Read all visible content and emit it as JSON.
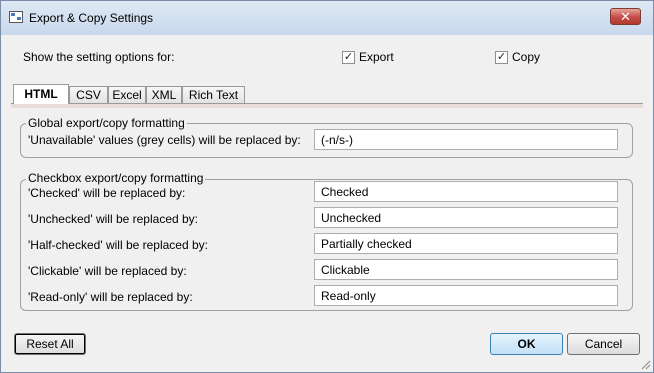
{
  "window": {
    "title": "Export & Copy Settings",
    "close_label": "✕"
  },
  "show_options": {
    "label": "Show the setting options for:",
    "export": {
      "label": "Export",
      "checked": true
    },
    "copy": {
      "label": "Copy",
      "checked": true
    }
  },
  "tabs": [
    {
      "label": "HTML",
      "active": true
    },
    {
      "label": "CSV",
      "active": false
    },
    {
      "label": "Excel",
      "active": false
    },
    {
      "label": "XML",
      "active": false
    },
    {
      "label": "Rich Text",
      "active": false
    }
  ],
  "global_group": {
    "title": "Global export/copy formatting",
    "unavailable_label": "'Unavailable' values (grey cells) will be replaced by:",
    "unavailable_value": "(-n/s-)"
  },
  "checkbox_group": {
    "title": "Checkbox export/copy formatting",
    "rows": [
      {
        "label": "'Checked' will be replaced by:",
        "value": "Checked"
      },
      {
        "label": "'Unchecked' will be replaced by:",
        "value": "Unchecked"
      },
      {
        "label": "'Half-checked' will be replaced by:",
        "value": "Partially checked"
      },
      {
        "label": "'Clickable' will be replaced by:",
        "value": "Clickable"
      },
      {
        "label": "'Read-only' will be replaced by:",
        "value": "Read-only"
      }
    ]
  },
  "buttons": {
    "reset": "Reset All",
    "ok": "OK",
    "cancel": "Cancel"
  },
  "colors": {
    "titlebar": "#c8d8ec",
    "close_button": "#c75050",
    "default_button": "#c4e0f6"
  }
}
